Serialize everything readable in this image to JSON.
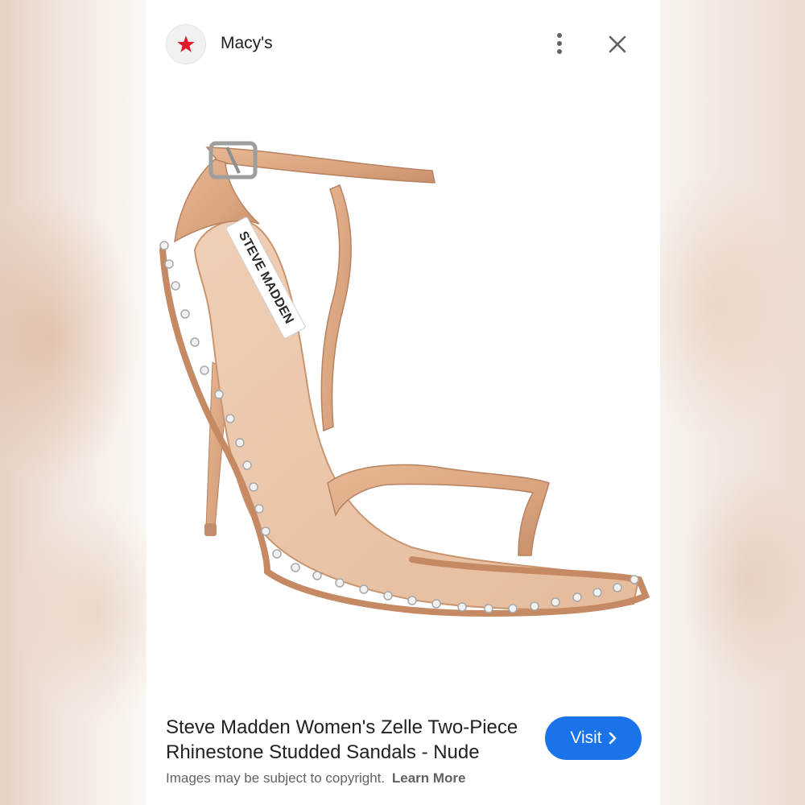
{
  "header": {
    "site_name": "Macy's",
    "logo_icon": "macys-star-icon",
    "menu_icon": "more-vert-icon",
    "close_icon": "close-icon"
  },
  "image": {
    "brand_label": "STEVE MADDEN"
  },
  "result": {
    "title": "Steve Madden Women's Zelle Two-Piece Rhinestone Studded Sandals - Nude",
    "visit_label": "Visit",
    "visit_icon": "chevron-right-icon",
    "copyright_text": "Images may be subject to copyright.",
    "learn_more_label": "Learn More"
  },
  "colors": {
    "accent": "#1a73e8",
    "logo_star": "#e21a2c",
    "sandal": "#d9a47e"
  }
}
